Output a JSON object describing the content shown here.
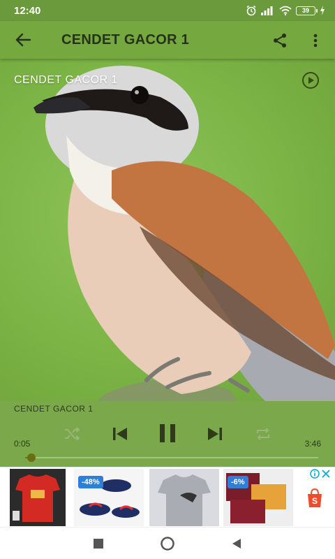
{
  "status_bar": {
    "time": "12:40",
    "battery_level": "39",
    "icons": [
      "alarm-icon",
      "signal-icon",
      "wifi-icon",
      "battery-icon",
      "charging-icon"
    ]
  },
  "app_bar": {
    "title": "CENDET GACOR 1",
    "back_icon": "arrow-left-icon",
    "share_icon": "share-icon",
    "more_icon": "more-vert-icon"
  },
  "artwork": {
    "overlay_title": "CENDET GACOR 1",
    "play_icon": "play-circle-icon"
  },
  "player": {
    "track_title": "CENDET GACOR 1",
    "elapsed": "0:05",
    "duration": "3:46",
    "progress_fraction": 0.022,
    "controls": [
      "shuffle-icon",
      "skip-previous-icon",
      "pause-icon",
      "skip-next-icon",
      "repeat-icon"
    ]
  },
  "ad": {
    "badges": [
      "-48%",
      "-6%"
    ],
    "icons": [
      "ad-info-icon",
      "ad-close-icon",
      "shop-bag-icon"
    ]
  },
  "nav_bar": {
    "icons": [
      "recents-square-icon",
      "home-circle-icon",
      "back-triangle-icon"
    ]
  },
  "colors": {
    "status_bar": "#6a9a3c",
    "app_bar": "#75a83f",
    "player_bg": "#7aa84a",
    "title_text": "#263218"
  }
}
